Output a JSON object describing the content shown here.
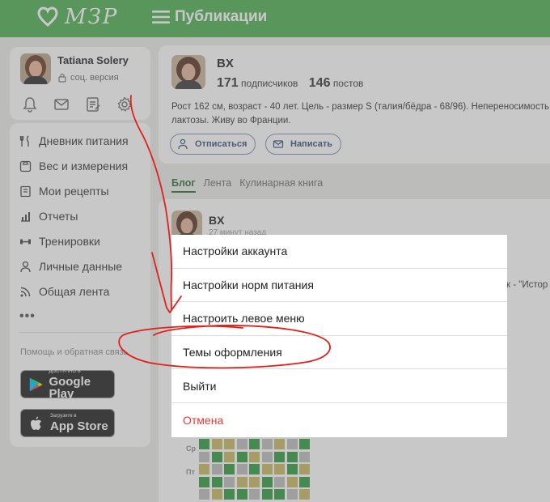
{
  "header": {
    "logo_text": "МЗР",
    "title": "Публикации"
  },
  "user": {
    "name": "Tatiana Solery",
    "version_label": "соц. версия"
  },
  "user_icons": [
    "bell-icon",
    "mail-icon",
    "notes-icon",
    "gear-icon"
  ],
  "nav": {
    "items": [
      {
        "label": "Дневник питания",
        "icon": "fork-knife-icon"
      },
      {
        "label": "Вес и измерения",
        "icon": "scale-icon"
      },
      {
        "label": "Мои рецепты",
        "icon": "recipe-book-icon"
      },
      {
        "label": "Отчеты",
        "icon": "bar-chart-icon"
      },
      {
        "label": "Тренировки",
        "icon": "dumbbell-icon"
      },
      {
        "label": "Личные данные",
        "icon": "person-icon"
      },
      {
        "label": "Общая лента",
        "icon": "rss-icon"
      }
    ],
    "more": "•••",
    "help": "Помощь и обратная связь"
  },
  "stores": {
    "google": {
      "small": "ДОСТУПНО В",
      "big": "Google Play"
    },
    "apple": {
      "small": "Загрузите в",
      "big": "App Store"
    }
  },
  "profile": {
    "name": "BX",
    "subscribers_count": "171",
    "subscribers_label": "подписчиков",
    "posts_count": "146",
    "posts_label": "постов",
    "bio_line1": "Рост 162 см, возраст - 40 лет. Цель - размер S (талия/бёдра - 68/96). Непереносимость",
    "bio_line2": "лактозы. Живу во Франции.",
    "unsubscribe_label": "Отписаться",
    "message_label": "Написать"
  },
  "tabs": [
    {
      "label": "Блог",
      "active": true
    },
    {
      "label": "Лента",
      "active": false
    },
    {
      "label": "Кулинарная книга",
      "active": false
    }
  ],
  "post": {
    "author": "BX",
    "time": "27 минут назад",
    "text_tail": "к - \"Истор",
    "day_labels": [
      "Ср",
      "Пт"
    ]
  },
  "action_sheet": {
    "items": [
      "Настройки аккаунта",
      "Настройки норм питания",
      "Настроить левое меню",
      "Темы оформления",
      "Выйти"
    ],
    "cancel": "Отмена"
  },
  "colors": {
    "brand_green": "#4caf50",
    "cell_green": "#2e9a3f",
    "cell_yellow": "#c9b860",
    "cell_grey": "#bdbdbd",
    "cancel_red": "#e53935",
    "annotation_red": "#e0211b"
  }
}
